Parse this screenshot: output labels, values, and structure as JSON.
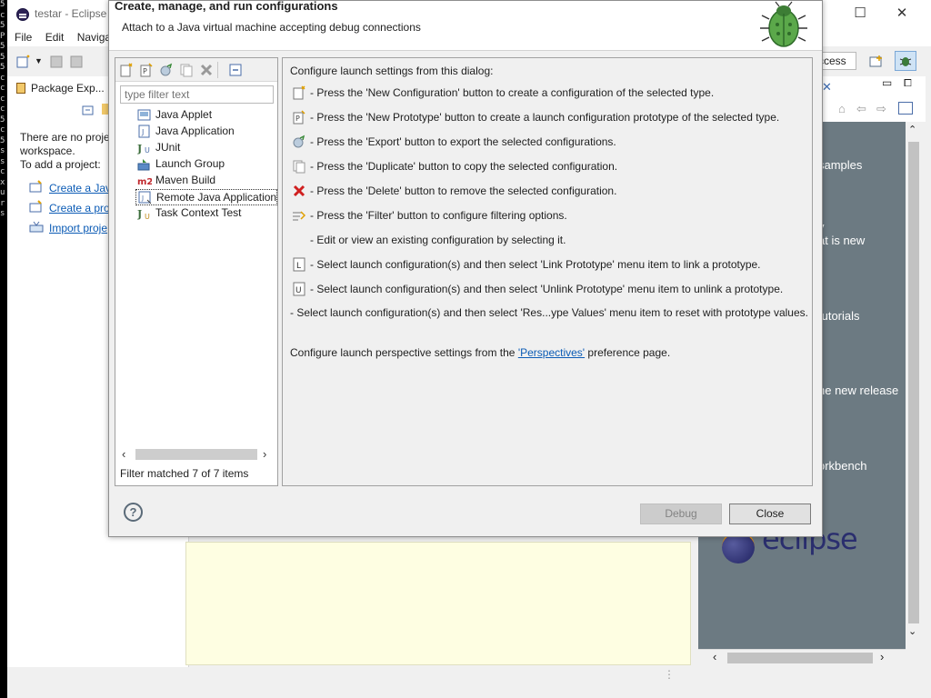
{
  "ide": {
    "title": "testar - Eclipse I",
    "menu": [
      "File",
      "Edit",
      "Navigat"
    ],
    "package_explorer": {
      "tab_title": "Package Exp...",
      "message_lines": [
        "There are no projec",
        "workspace.",
        "To add a project:"
      ],
      "links": [
        "Create a Java",
        "Create a proj",
        "Import proje"
      ]
    },
    "quick_access": "ccess",
    "welcome_items": [
      "samples",
      "y",
      "at is new",
      "tutorials",
      "he new release",
      "orkbench"
    ],
    "logo_text": "eclipse",
    "console_chars": [
      "5",
      "c",
      "5",
      "P",
      "5",
      "5",
      "5",
      "c",
      "c",
      "c",
      "c",
      "5",
      "c",
      "",
      "",
      "5",
      "s",
      "",
      "",
      "s",
      "",
      "",
      "c",
      "x",
      "u",
      "r",
      "s"
    ]
  },
  "dialog": {
    "title": "Create, manage, and run configurations",
    "subtitle": "Attach to a Java virtual machine accepting debug connections",
    "filter_placeholder": "type filter text",
    "tree_items": [
      {
        "label": "Java Applet",
        "icon": "java-applet-icon"
      },
      {
        "label": "Java Application",
        "icon": "java-application-icon"
      },
      {
        "label": "JUnit",
        "icon": "junit-icon"
      },
      {
        "label": "Launch Group",
        "icon": "launch-group-icon"
      },
      {
        "label": "Maven Build",
        "icon": "maven-icon"
      },
      {
        "label": "Remote Java Application",
        "icon": "remote-java-icon",
        "selected": true
      },
      {
        "label": "Task Context Test",
        "icon": "task-context-icon"
      }
    ],
    "filter_status": "Filter matched 7 of 7 items",
    "intro": "Configure launch settings from this dialog:",
    "instructions": [
      {
        "icon": "new-config-icon",
        "text": "- Press the 'New Configuration' button to create a configuration of the selected type."
      },
      {
        "icon": "new-prototype-icon",
        "text": "- Press the 'New Prototype' button to create a launch configuration prototype of the selected type."
      },
      {
        "icon": "export-icon",
        "text": "- Press the 'Export' button to export the selected configurations."
      },
      {
        "icon": "duplicate-icon",
        "text": "- Press the 'Duplicate' button to copy the selected configuration."
      },
      {
        "icon": "delete-icon",
        "text": "- Press the 'Delete' button to remove the selected configuration."
      },
      {
        "icon": "filter-icon",
        "text": "- Press the 'Filter' button to configure filtering options."
      },
      {
        "icon": "",
        "text": "- Edit or view an existing configuration by selecting it."
      },
      {
        "icon": "link-prototype-icon",
        "text": "- Select launch configuration(s) and then select 'Link Prototype' menu item to link a prototype."
      },
      {
        "icon": "unlink-prototype-icon",
        "text": "- Select launch configuration(s) and then select 'Unlink Prototype' menu item to unlink a prototype."
      }
    ],
    "reset_line": "- Select launch configuration(s) and then select 'Res...ype Values' menu item to reset with prototype values.",
    "perspectives_prefix": "Configure launch perspective settings from the ",
    "perspectives_link": "'Perspectives'",
    "perspectives_suffix": " preference page.",
    "buttons": {
      "debug": "Debug",
      "close": "Close",
      "help": "?"
    }
  }
}
